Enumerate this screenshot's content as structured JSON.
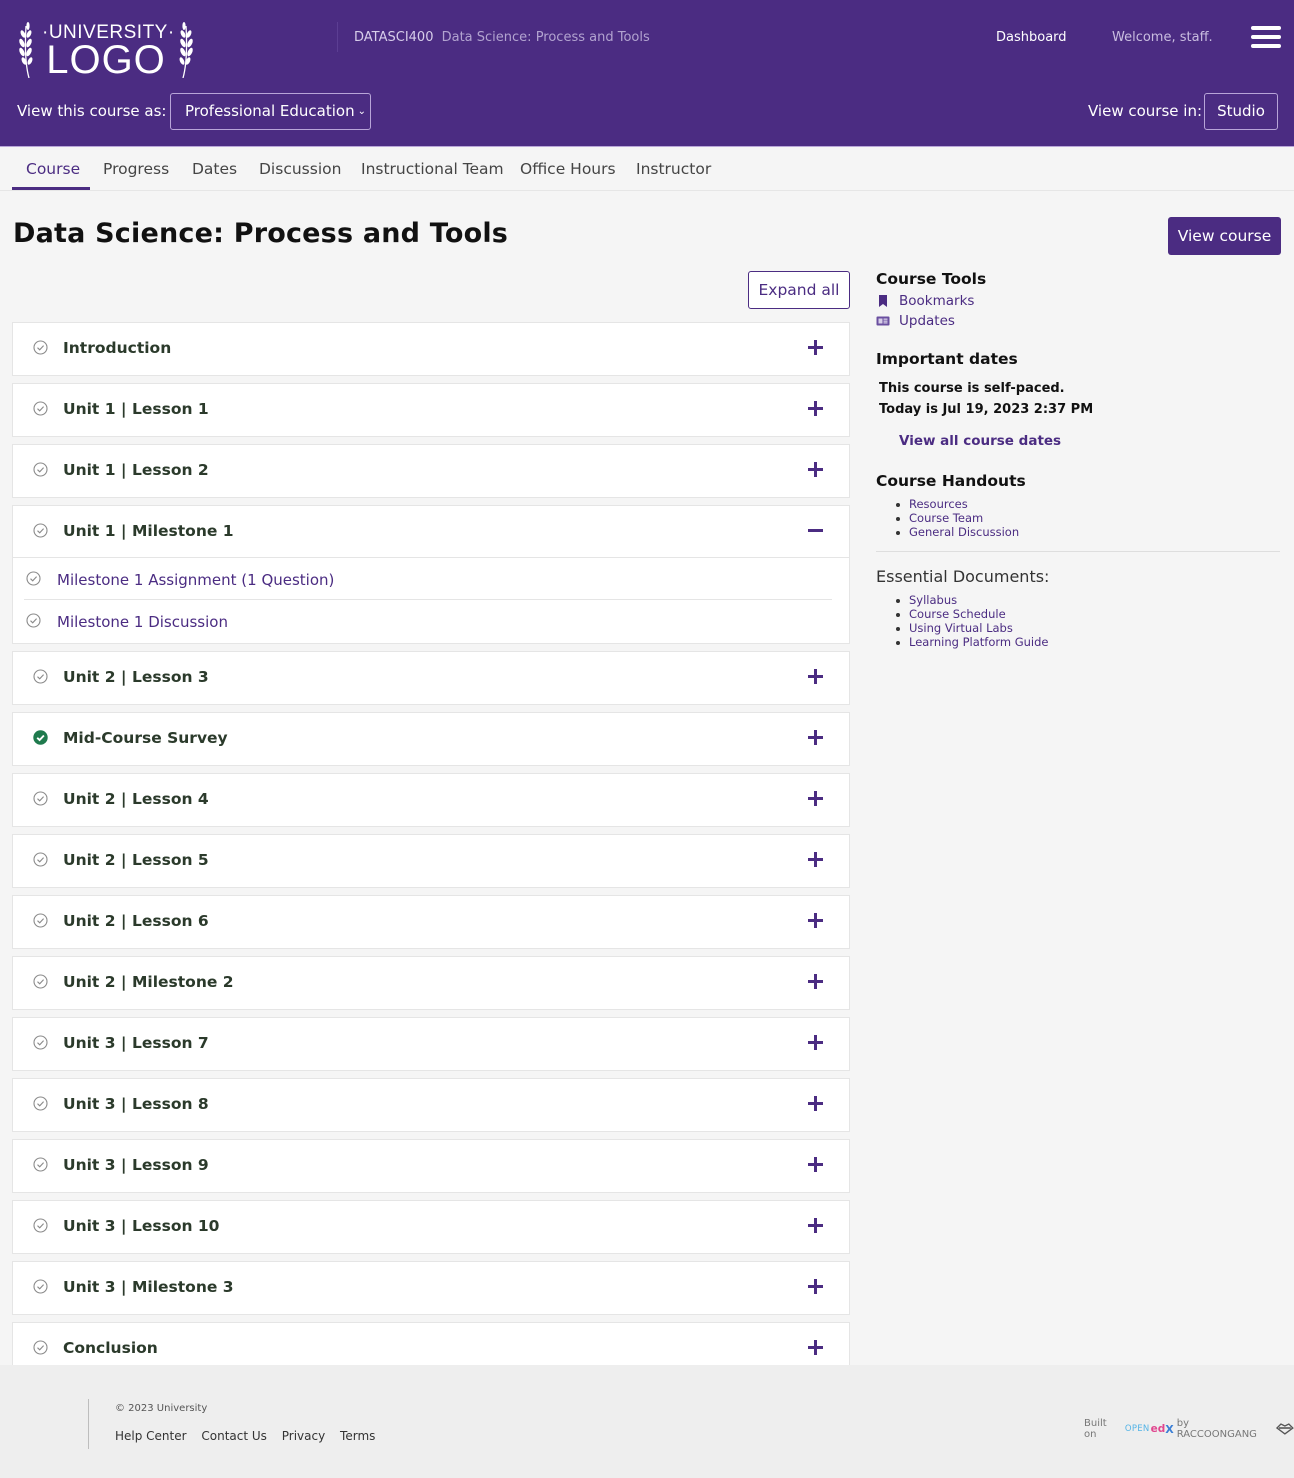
{
  "header": {
    "logo": {
      "top_text": "·UNIVERSITY·",
      "main_text": "LOGO"
    },
    "course_code": "DATASCI400",
    "course_name": "Data Science: Process and Tools",
    "nav": {
      "dashboard": "Dashboard",
      "welcome": "Welcome, staff."
    },
    "view_as_label": "View this course as:",
    "view_as_selected": "Professional Education",
    "view_in_label": "View course in:",
    "studio_button": "Studio"
  },
  "tabs": [
    {
      "label": "Course",
      "active": true
    },
    {
      "label": "Progress"
    },
    {
      "label": "Dates"
    },
    {
      "label": "Discussion"
    },
    {
      "label": "Instructional Team"
    },
    {
      "label": "Office Hours"
    },
    {
      "label": "Instructor"
    }
  ],
  "main": {
    "title": "Data Science: Process and Tools",
    "view_course_button": "View course",
    "expand_all_button": "Expand all",
    "sections": [
      {
        "title": "Introduction",
        "complete": false,
        "expanded": false
      },
      {
        "title": "Unit 1 | Lesson 1",
        "complete": false,
        "expanded": false
      },
      {
        "title": "Unit 1 | Lesson 2",
        "complete": false,
        "expanded": false
      },
      {
        "title": "Unit 1 | Milestone 1",
        "complete": false,
        "expanded": true,
        "subsections": [
          {
            "title": "Milestone 1 Assignment (1 Question)"
          },
          {
            "title": "Milestone 1 Discussion"
          }
        ]
      },
      {
        "title": "Unit 2 | Lesson 3",
        "complete": false,
        "expanded": false
      },
      {
        "title": "Mid-Course Survey",
        "complete": true,
        "expanded": false
      },
      {
        "title": "Unit 2 | Lesson 4",
        "complete": false,
        "expanded": false
      },
      {
        "title": "Unit 2 | Lesson 5",
        "complete": false,
        "expanded": false
      },
      {
        "title": "Unit 2 | Lesson 6",
        "complete": false,
        "expanded": false
      },
      {
        "title": "Unit 2 | Milestone 2",
        "complete": false,
        "expanded": false
      },
      {
        "title": "Unit 3 | Lesson 7",
        "complete": false,
        "expanded": false
      },
      {
        "title": "Unit 3 | Lesson 8",
        "complete": false,
        "expanded": false
      },
      {
        "title": "Unit 3 | Lesson 9",
        "complete": false,
        "expanded": false
      },
      {
        "title": "Unit 3 | Lesson 10",
        "complete": false,
        "expanded": false
      },
      {
        "title": "Unit 3 | Milestone 3",
        "complete": false,
        "expanded": false
      },
      {
        "title": "Conclusion",
        "complete": false,
        "expanded": false
      }
    ]
  },
  "sidebar": {
    "course_tools_heading": "Course Tools",
    "tools": [
      {
        "label": "Bookmarks",
        "icon": "bookmark-icon"
      },
      {
        "label": "Updates",
        "icon": "newspaper-icon"
      }
    ],
    "important_dates_heading": "Important dates",
    "self_paced_text": "This course is self-paced.",
    "today_text": "Today is Jul 19, 2023 2:37 PM",
    "view_all_dates_link": "View all course dates",
    "handouts_heading": "Course Handouts",
    "handouts": [
      "Resources",
      "Course Team",
      "General Discussion"
    ],
    "essential_heading": "Essential Documents:",
    "essential_docs": [
      "Syllabus",
      "Course Schedule",
      "Using Virtual Labs",
      "Learning Platform Guide"
    ]
  },
  "footer": {
    "copyright": "© 2023 University",
    "links": [
      "Help Center",
      "Contact Us",
      "Privacy",
      "Terms"
    ],
    "built_on_prefix": "Built on",
    "built_on_open": "OPEN",
    "built_on_ed": "ed",
    "built_on_x": "X",
    "built_on_suffix": "by RACCOONGANG"
  },
  "colors": {
    "brand": "#4b2c82",
    "complete": "#1f7a4d",
    "page_bg": "#f5f5f5"
  }
}
